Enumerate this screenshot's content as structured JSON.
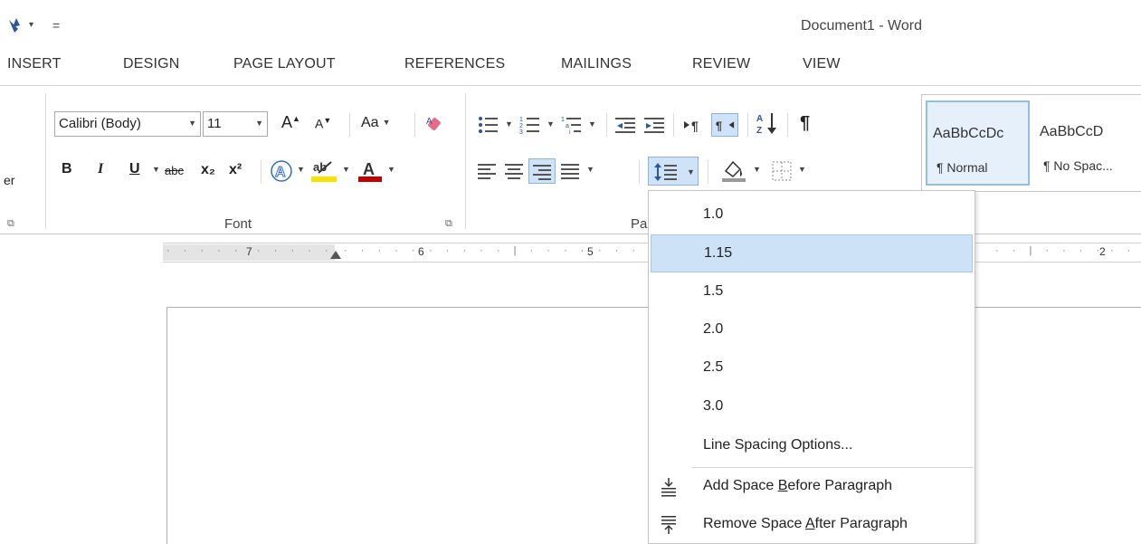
{
  "title_bar": {
    "qat_dropdown": "▾",
    "qat_customize": "=",
    "document_title": "Document1 - Word"
  },
  "tabs": [
    "INSERT",
    "DESIGN",
    "PAGE LAYOUT",
    "REFERENCES",
    "MAILINGS",
    "REVIEW",
    "VIEW"
  ],
  "ribbon": {
    "clipboard_partial_label": "er",
    "font": {
      "font_name": "Calibri (Body)",
      "font_size": "11",
      "change_case": "Aa",
      "group_label": "Font",
      "bold": "B",
      "italic": "I",
      "underline": "U",
      "strikethrough": "abc",
      "subscript": "x₂",
      "superscript": "x²",
      "grow_font": "A",
      "shrink_font": "A"
    },
    "paragraph": {
      "group_label_partial": "Pa",
      "show_marks": "¶"
    },
    "styles": [
      {
        "sample": "AaBbCcDc",
        "name": "¶ Normal"
      },
      {
        "sample": "AaBbCcD",
        "name": "¶ No Spac..."
      }
    ]
  },
  "ruler": {
    "numbers": [
      "7",
      "6",
      "5",
      "2"
    ]
  },
  "line_spacing_menu": {
    "items": [
      "1.0",
      "1.15",
      "1.5",
      "2.0",
      "2.5",
      "3.0",
      "Line Spacing Options..."
    ],
    "selected": "1.15",
    "add_space_before": {
      "pre": "Add Space ",
      "acc": "B",
      "post": "efore Paragraph"
    },
    "remove_space_after": {
      "pre": "Remove Space ",
      "acc": "A",
      "post": "fter Paragraph"
    }
  },
  "colors": {
    "highlight_yellow": "#f5e400",
    "font_color_red": "#c00000",
    "selection_blue": "#cde1f7",
    "text_effects_blue": "#2f6cc4"
  }
}
